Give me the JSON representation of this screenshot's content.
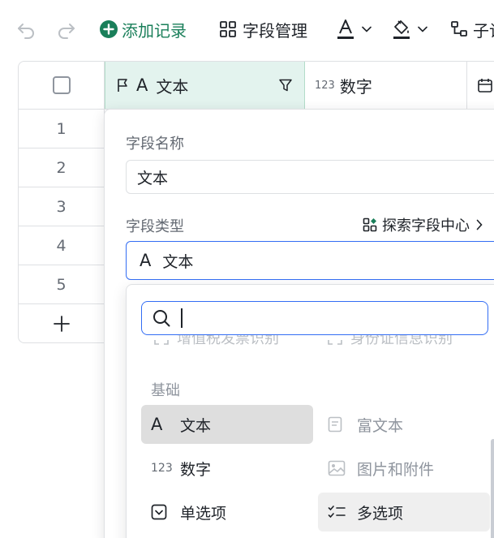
{
  "toolbar": {
    "add_record": "添加记录",
    "field_manage": "字段管理",
    "sub_label": "子记"
  },
  "grid": {
    "col_text": "文本",
    "col_number": "数字",
    "col_number_prefix": "123",
    "rows": [
      "1",
      "2",
      "3",
      "4",
      "5"
    ]
  },
  "field_panel": {
    "name_label": "字段名称",
    "name_value": "文本",
    "type_label": "字段类型",
    "explore_link": "探索字段中心",
    "selected_type": "文本"
  },
  "type_dropdown": {
    "search_value": "",
    "faded_items": [
      "增值税发票识别",
      "身份证信息识别"
    ],
    "group_title": "基础",
    "items": [
      {
        "label": "文本",
        "icon": "text-a-icon",
        "selected": true
      },
      {
        "label": "富文本",
        "icon": "rich-text-icon",
        "disabled": true
      },
      {
        "label": "数字",
        "icon": "number-123-icon"
      },
      {
        "label": "图片和附件",
        "icon": "image-icon",
        "disabled": true
      },
      {
        "label": "单选项",
        "icon": "single-select-icon"
      },
      {
        "label": "多选项",
        "icon": "multi-select-icon",
        "hovered": true
      }
    ],
    "number_icon_text": "123"
  },
  "colors": {
    "accent_green": "#1a7f5a",
    "focus_blue": "#336df4",
    "header_selected_bg": "#e3f3ee"
  }
}
